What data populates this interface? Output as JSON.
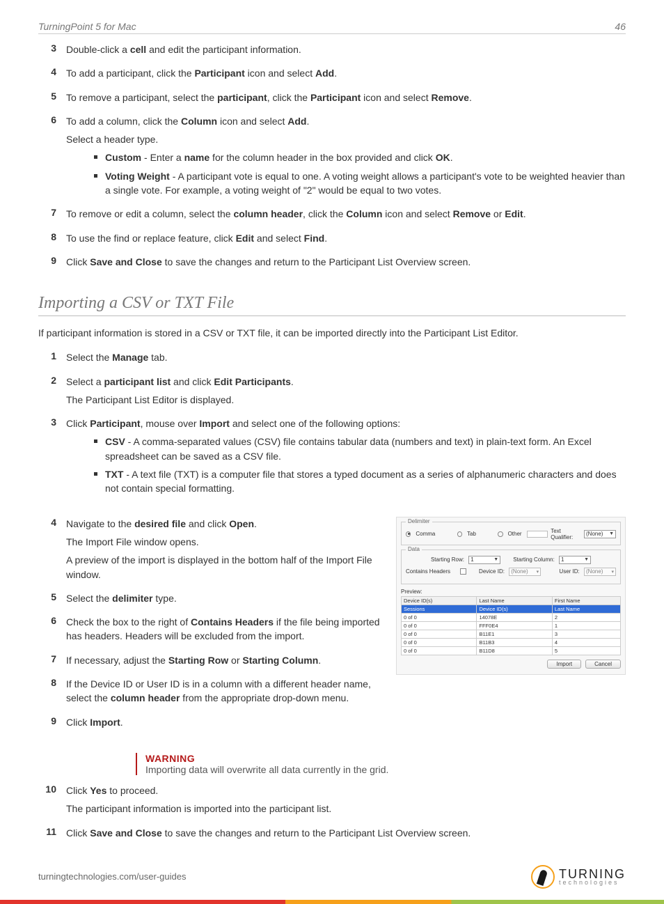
{
  "header": {
    "title": "TurningPoint 5 for Mac",
    "page": "46"
  },
  "steps_top": {
    "s3": "Double-click a <b>cell</b> and edit the participant information.",
    "s4": "To add a participant, click the <b>Participant</b> icon and select <b>Add</b>.",
    "s5": "To remove a participant, select the <b>participant</b>, click the <b>Participant</b> icon and select <b>Remove</b>.",
    "s6": "To add a column, click the <b>Column</b> icon and select <b>Add</b>.",
    "s6b": "Select a header type.",
    "s6_b1": "<b>Custom</b> - Enter a <b>name</b> for the column header in the box provided and click <b>OK</b>.",
    "s6_b2": "<b>Voting Weight</b> - A participant vote is equal to one. A voting weight allows a participant's vote to be weighted heavier than a single vote. For example, a voting weight of \"2\" would be equal to two votes.",
    "s7": "To remove or edit a column, select the <b>column header</b>, click the <b>Column</b> icon and select <b>Remove</b> or <b>Edit</b>.",
    "s8": "To use the find or replace feature, click <b>Edit</b> and select <b>Find</b>.",
    "s9": "Click <b>Save and Close</b> to save the changes and return to the Participant List Overview screen."
  },
  "section_title": "Importing a CSV or TXT File",
  "intro": "If participant information is stored in a CSV or TXT file, it can be imported directly into the Participant List Editor.",
  "steps_import": {
    "s1": "Select the <b>Manage</b> tab.",
    "s2": "Select a <b>participant list</b> and click <b>Edit Participants</b>.",
    "s2b": "The Participant List Editor is displayed.",
    "s3": "Click <b>Participant</b>, mouse over <b>Import</b> and select one of the following options:",
    "s3_b1": "<b>CSV</b> - A comma-separated values (CSV) file contains tabular data (numbers and text) in plain-text form. An Excel spreadsheet can be saved as a CSV file.",
    "s3_b2": "<b>TXT</b> - A text file (TXT) is a computer file that stores a typed document as a series of alphanumeric characters and does not contain special formatting.",
    "s4": "Navigate to the <b>desired file</b> and click <b>Open</b>.",
    "s4b": "The Import File window opens.",
    "s4c": "A preview of the import is displayed in the bottom half of the Import File window.",
    "s5": "Select the <b>delimiter</b> type.",
    "s6": "Check the box to the right of <b>Contains Headers</b> if the file being imported has headers. Headers will be excluded from the import.",
    "s7": "If necessary, adjust the <b>Starting Row</b> or <b>Starting Column</b>.",
    "s8": "If the Device ID or User ID is in a column with a different header name, select the <b>column header</b> from the appropriate drop-down menu.",
    "s9": "Click <b>Import</b>.",
    "s10": "Click <b>Yes</b> to proceed.",
    "s10b": "The participant information is imported into the participant list.",
    "s11": "Click <b>Save and Close</b> to save the changes and return to the Participant List Overview screen."
  },
  "warning": {
    "title": "WARNING",
    "text": "Importing data will overwrite all data currently in the grid."
  },
  "screenshot": {
    "delimiter_legend": "Delimiter",
    "opt_comma": "Comma",
    "opt_tab": "Tab",
    "opt_other": "Other",
    "text_qualifier_label": "Text Qualifier:",
    "text_qualifier_value": "(None)",
    "data_legend": "Data",
    "starting_row_label": "Starting Row:",
    "starting_row_value": "1",
    "starting_column_label": "Starting Column:",
    "starting_column_value": "1",
    "contains_headers_label": "Contains Headers",
    "device_id_label": "Device ID:",
    "device_id_value": "(None)",
    "user_id_label": "User ID:",
    "user_id_value": "(None)",
    "preview_label": "Preview:",
    "headers": [
      "Device ID(s)",
      "Last Name",
      "First Name"
    ],
    "rows": [
      [
        "Sessions",
        "Device ID(s)",
        "Last Name"
      ],
      [
        "0 of 0",
        "14078E",
        "2"
      ],
      [
        "0 of 0",
        "FFF0E4",
        "1"
      ],
      [
        "0 of 0",
        "B11E1",
        "3"
      ],
      [
        "0 of 0",
        "B11B3",
        "4"
      ],
      [
        "0 of 0",
        "B11D8",
        "5"
      ]
    ],
    "btn_import": "Import",
    "btn_cancel": "Cancel"
  },
  "footer": {
    "url": "turningtechnologies.com/user-guides",
    "logo1": "TURNING",
    "logo2": "technologies"
  }
}
